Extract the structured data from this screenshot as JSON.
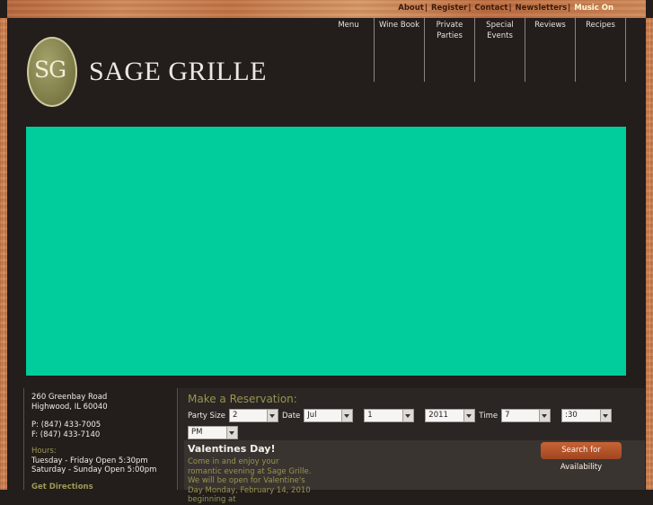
{
  "top_links": {
    "about": "About",
    "register": "Register",
    "contact": "Contact",
    "newsletters": "Newsletters",
    "music": "Music On",
    "separator": "|"
  },
  "nav": {
    "items": [
      {
        "label": "Menu"
      },
      {
        "label": "Wine Book"
      },
      {
        "label": "Private Parties"
      },
      {
        "label": "Special Events"
      },
      {
        "label": "Reviews"
      },
      {
        "label": "Recipes"
      }
    ]
  },
  "logo": {
    "monogram": "SG",
    "name": "SAGE GRILLE"
  },
  "banner": {
    "color": "#00cc9c"
  },
  "info": {
    "address_line1": "260 Greenbay Road",
    "address_line2": "Highwood, IL 60040",
    "phone": "P:  (847) 433-7005",
    "fax": "F:  (847) 433-7140",
    "hours_label": "Hours:",
    "hours_line1": "Tuesday - Friday Open 5:30pm",
    "hours_line2": "Saturday - Sunday Open 5:00pm",
    "directions": "Get Directions"
  },
  "reservation": {
    "title": "Make a Reservation:",
    "party_size_label": "Party Size",
    "party_size_value": "2",
    "date_label": "Date",
    "month_value": "Jul",
    "day_value": "1",
    "year_value": "2011",
    "time_label": "Time",
    "hour_value": "7",
    "minute_value": ":30",
    "ampm_value": "PM",
    "search_button": "Search for Availability"
  },
  "event": {
    "title": "Valentines Day!",
    "body": "Come in and enjoy your romantic evening at Sage Grille. We will be open for Valentine's Day Monday, February 14, 2010 beginning at"
  },
  "colors": {
    "accent": "#97954f",
    "button": "#b4542b",
    "background": "#231d1b"
  }
}
